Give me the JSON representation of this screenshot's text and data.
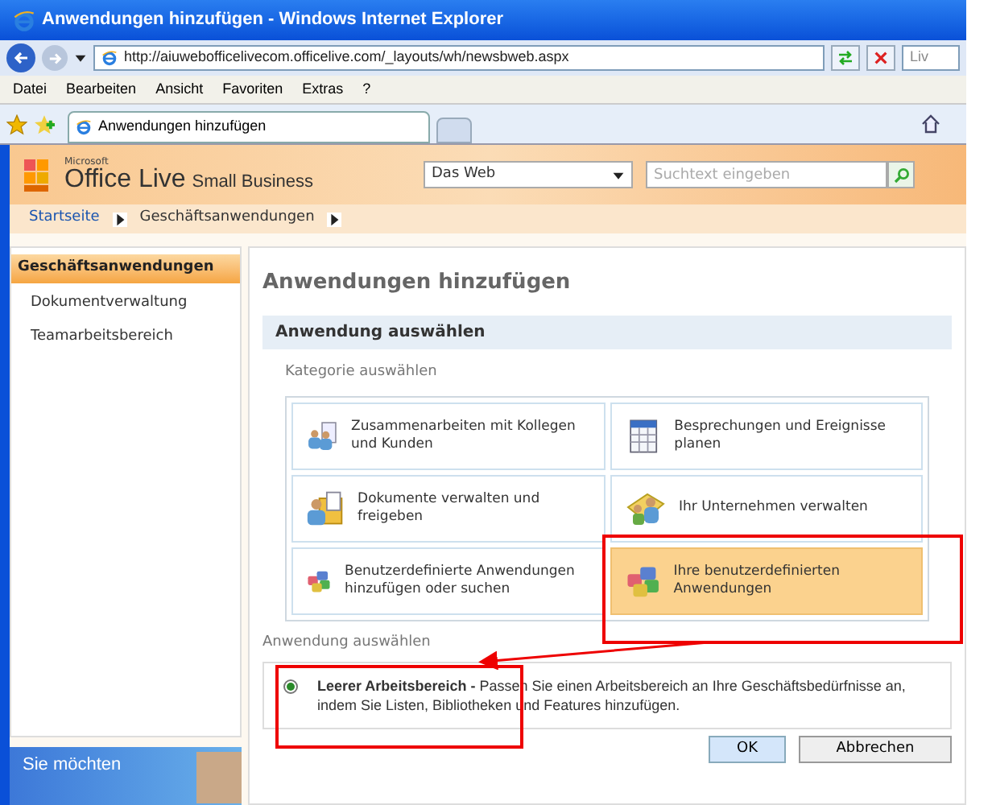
{
  "window": {
    "title": "Anwendungen hinzufügen - Windows Internet Explorer"
  },
  "address_bar": {
    "url": "http://aiuwebofficelivecom.officelive.com/_layouts/wh/newsbweb.aspx",
    "search_text": "Liv"
  },
  "menu": [
    "Datei",
    "Bearbeiten",
    "Ansicht",
    "Favoriten",
    "Extras",
    "?"
  ],
  "tabs": [
    {
      "label": "Anwendungen hinzufügen",
      "selected": true
    }
  ],
  "site_header": {
    "brand_small": "Microsoft",
    "brand": "Office Live",
    "brand_suffix": "Small Business",
    "scope": "Das Web",
    "search": {
      "placeholder": "Suchtext eingeben"
    }
  },
  "breadcrumb": [
    "Startseite",
    "Geschäftsanwendungen"
  ],
  "sidebar": {
    "items": [
      {
        "label": "Geschäftsanwendungen",
        "selected": true
      },
      {
        "label": "Dokumentverwaltung",
        "selected": false
      },
      {
        "label": "Teamarbeitsbereich",
        "selected": false
      }
    ],
    "ad": {
      "text": "Sie möchten"
    }
  },
  "page_title": "Anwendungen hinzufügen",
  "panel": {
    "title": "Anwendung auswählen",
    "category_label": "Kategorie auswählen",
    "categories": [
      {
        "label": "Zusammenarbeiten mit Kollegen und Kunden",
        "kind": "people",
        "selected": false
      },
      {
        "label": "Besprechungen und Ereignisse planen",
        "kind": "calendar",
        "selected": false
      },
      {
        "label": "Dokumente verwalten und freigeben",
        "kind": "folder",
        "selected": false
      },
      {
        "label": "Ihr Unternehmen verwalten",
        "kind": "organization",
        "selected": false
      },
      {
        "label": "Benutzerdefinierte Anwendungen hinzufügen oder suchen",
        "kind": "blocks",
        "selected": false
      },
      {
        "label": "Ihre benutzerdefinierten Anwendungen",
        "kind": "blocks",
        "selected": true
      }
    ],
    "app_label": "Anwendung auswählen",
    "options": [
      {
        "text": "**Leerer Arbeitsbereich -** Passen Sie einen Arbeitsbereich an Ihre Geschäftsbedürfnisse an, indem Sie Listen, Bibliotheken und Features hinzufügen.",
        "selected": true
      }
    ]
  },
  "buttons": [
    {
      "label": "OK",
      "kind": "primary"
    },
    {
      "label": "Abbrechen",
      "kind": "secondary"
    }
  ]
}
